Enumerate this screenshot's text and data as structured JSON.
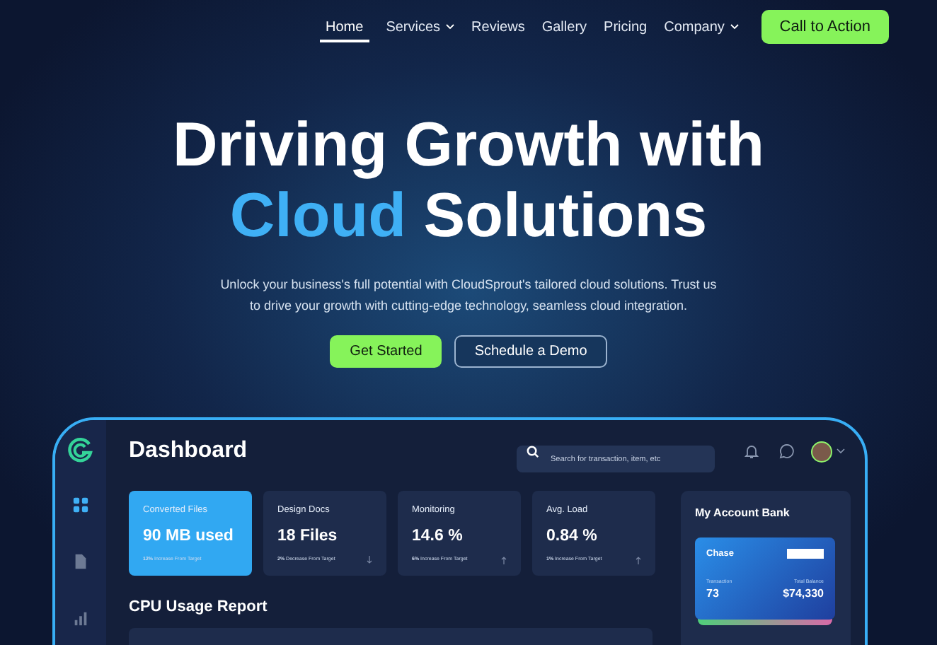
{
  "nav": {
    "items": [
      {
        "label": "Home",
        "selected": true,
        "has_menu": false
      },
      {
        "label": "Services",
        "selected": false,
        "has_menu": true
      },
      {
        "label": "Reviews",
        "selected": false,
        "has_menu": false
      },
      {
        "label": "Gallery",
        "selected": false,
        "has_menu": false
      },
      {
        "label": "Pricing",
        "selected": false,
        "has_menu": false
      },
      {
        "label": "Company",
        "selected": false,
        "has_menu": true
      }
    ],
    "cta": "Call to Action"
  },
  "hero": {
    "headline": [
      [
        {
          "text": "Driving Growth with",
          "highlight": false
        }
      ],
      [
        {
          "text": "Cloud",
          "highlight": true
        },
        {
          "text": "Solutions",
          "highlight": false
        }
      ]
    ],
    "description": "Unlock your business's full potential with CloudSprout's tailored cloud solutions. Trust us to drive your growth with cutting-edge technology, seamless cloud integration.",
    "buttons": [
      {
        "label": "Get Started",
        "kind": "primary"
      },
      {
        "label": "Schedule a Demo",
        "kind": "outline"
      }
    ]
  },
  "dashboard": {
    "title": "Dashboard",
    "search": {
      "placeholder": "Search for transaction, item, etc"
    },
    "sidebar": [
      {
        "selected": true
      },
      {
        "selected": false
      },
      {
        "selected": false
      }
    ],
    "stats": [
      {
        "label": "Converted Files",
        "value": "90 MB used",
        "change": "12%",
        "note": "Increase From Target",
        "kind": "plain",
        "selected": true
      },
      {
        "label": "Design Docs",
        "value": "18 Files",
        "change": "2%",
        "note": "Decrease From Target",
        "kind": "down",
        "selected": false
      },
      {
        "label": "Monitoring",
        "value": "14.6 %",
        "change": "6%",
        "note": "Increase From Target",
        "kind": "up",
        "selected": false
      },
      {
        "label": "Avg. Load",
        "value": "0.84 %",
        "change": "1%",
        "note": "Increase From Target",
        "kind": "up",
        "selected": false
      }
    ],
    "cpu_title": "CPU Usage Report",
    "account": {
      "title": "My Account Bank",
      "card": {
        "bank": "Chase",
        "transaction_label": "Transaction",
        "transaction": "73",
        "balance_label": "Total Balance",
        "balance": "$74,330"
      }
    }
  }
}
